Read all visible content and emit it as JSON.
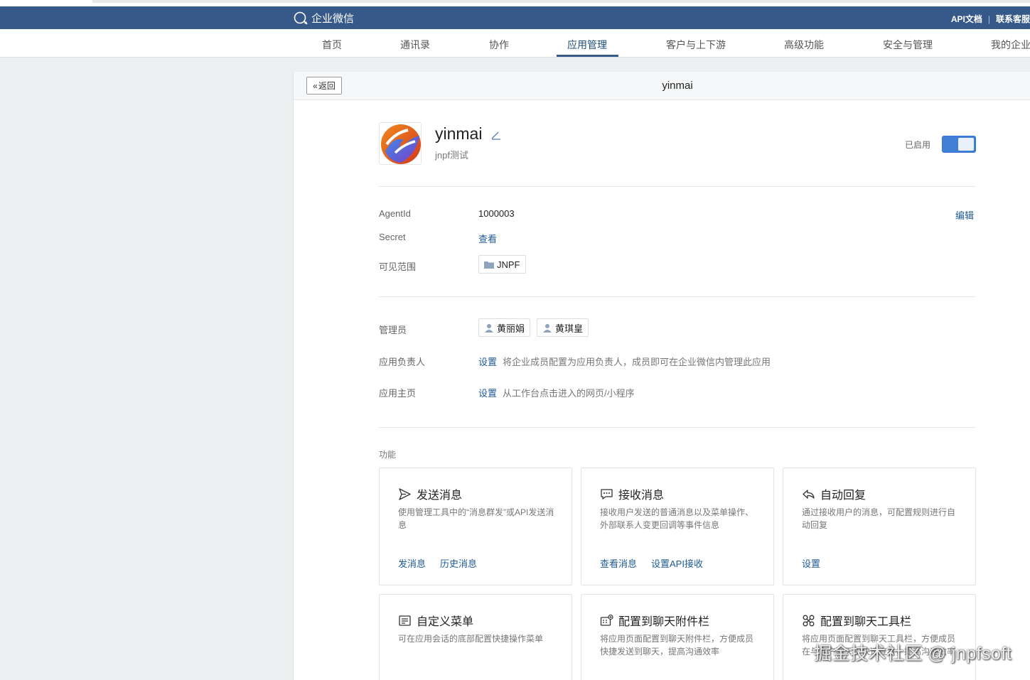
{
  "header": {
    "logo_text": "企业微信",
    "links": [
      "API文档",
      "联系客服"
    ],
    "bg_color": "#36598a"
  },
  "nav": {
    "items": [
      "首页",
      "通讯录",
      "协作",
      "应用管理",
      "客户与上下游",
      "高级功能",
      "安全与管理",
      "我的企业"
    ],
    "active": "应用管理"
  },
  "titlebar": {
    "back_label": "返回",
    "title": "yinmai"
  },
  "app": {
    "name": "yinmai",
    "description": "jnpf测试",
    "status_label": "已启用",
    "enabled": true
  },
  "details": {
    "edit_label": "编辑",
    "agentid_label": "AgentId",
    "agentid_value": "1000003",
    "secret_label": "Secret",
    "secret_action": "查看",
    "scope_label": "可见范围",
    "scope_value": "JNPF"
  },
  "admin": {
    "admin_label": "管理员",
    "admins": [
      "黄丽娟",
      "黄琪皇"
    ],
    "owner_label": "应用负责人",
    "owner_action": "设置",
    "owner_hint": "将企业成员配置为应用负责人，成员即可在企业微信内管理此应用",
    "home_label": "应用主页",
    "home_action": "设置",
    "home_hint": "从工作台点击进入的网页/小程序"
  },
  "features": {
    "section_label": "功能",
    "cards": [
      {
        "title": "发送消息",
        "icon": "send-icon",
        "desc": "使用管理工具中的“消息群发”或API发送消息",
        "actions": [
          "发消息",
          "历史消息"
        ]
      },
      {
        "title": "接收消息",
        "icon": "chat-bubble-icon",
        "desc": "接收用户发送的普通消息以及菜单操作、外部联系人变更回调等事件信息",
        "actions": [
          "查看消息",
          "设置API接收"
        ]
      },
      {
        "title": "自动回复",
        "icon": "reply-icon",
        "desc": "通过接收用户的消息，可配置规则进行自动回复",
        "actions": [
          "设置"
        ]
      },
      {
        "title": "自定义菜单",
        "icon": "menu-icon",
        "desc": "可在应用会话的底部配置快捷操作菜单",
        "actions": []
      },
      {
        "title": "配置到聊天附件栏",
        "icon": "attachment-bar-icon",
        "desc": "将应用页面配置到聊天附件栏，方便成员快捷发送到聊天，提高沟通效率",
        "actions": []
      },
      {
        "title": "配置到聊天工具栏",
        "icon": "toolbar-icon",
        "desc": "将应用页面配置到聊天工具栏，方便成员在与客户聊天中快速查看，提高沟通效率",
        "actions": []
      }
    ]
  },
  "watermark": "掘金技术社区 @ jnpfsoft"
}
